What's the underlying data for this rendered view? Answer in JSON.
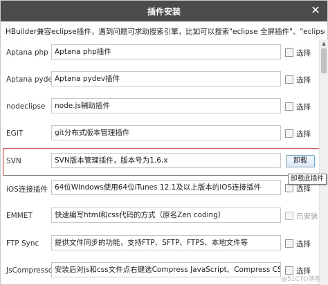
{
  "dialog": {
    "title": "插件安装",
    "close_icon": "close-icon"
  },
  "hint": "HBuilder兼容eclipse插件，遇到问题可求助搜索引擎，比如可以搜索\"eclipse 全屏插件\"、\"eclipse SVN用法\"",
  "plugins": [
    {
      "name": "Aptana php",
      "desc": "Aptana php插件",
      "check_label": "选择",
      "installed": false
    },
    {
      "name": "Aptana pydev",
      "desc": "Aptana pydev插件",
      "check_label": "选择",
      "installed": false
    },
    {
      "name": "nodeclipse",
      "desc": "node.js辅助插件",
      "check_label": "选择",
      "installed": false
    },
    {
      "name": "EGIT",
      "desc": "git分布式版本管理插件",
      "check_label": "选择",
      "installed": false
    },
    {
      "name": "SVN",
      "desc": "SVN版本管理插件，版本号为1.6.x",
      "button": "卸载",
      "tooltip": "卸载此插件",
      "installed": true
    },
    {
      "name": "iOS连接插件",
      "desc": "64位Windows使用64位iTunes 12.1及以上版本的iOS连接插件",
      "check_label": "选择",
      "installed": false
    },
    {
      "name": "EMMET",
      "desc": "快速编写html和css代码的方式（原名Zen coding）",
      "check_label": "已安装",
      "installed": true,
      "disabled": true
    },
    {
      "name": "FTP Sync",
      "desc": "提供文件同步的功能，支持FTP、SFTP、FTPS、本地文件等",
      "check_label": "选择",
      "installed": false
    },
    {
      "name": "JsCompressor",
      "desc": "安装后对js和css文件点右键选Compress JavaScript、Compress CSS即可压缩",
      "check_label": "选择",
      "installed": false
    }
  ],
  "watermark": "@51CTO博客",
  "colors": {
    "titlebar": "#4b4b4b",
    "highlight_frame": "#e0554d",
    "button_border": "#6a9fd1"
  }
}
